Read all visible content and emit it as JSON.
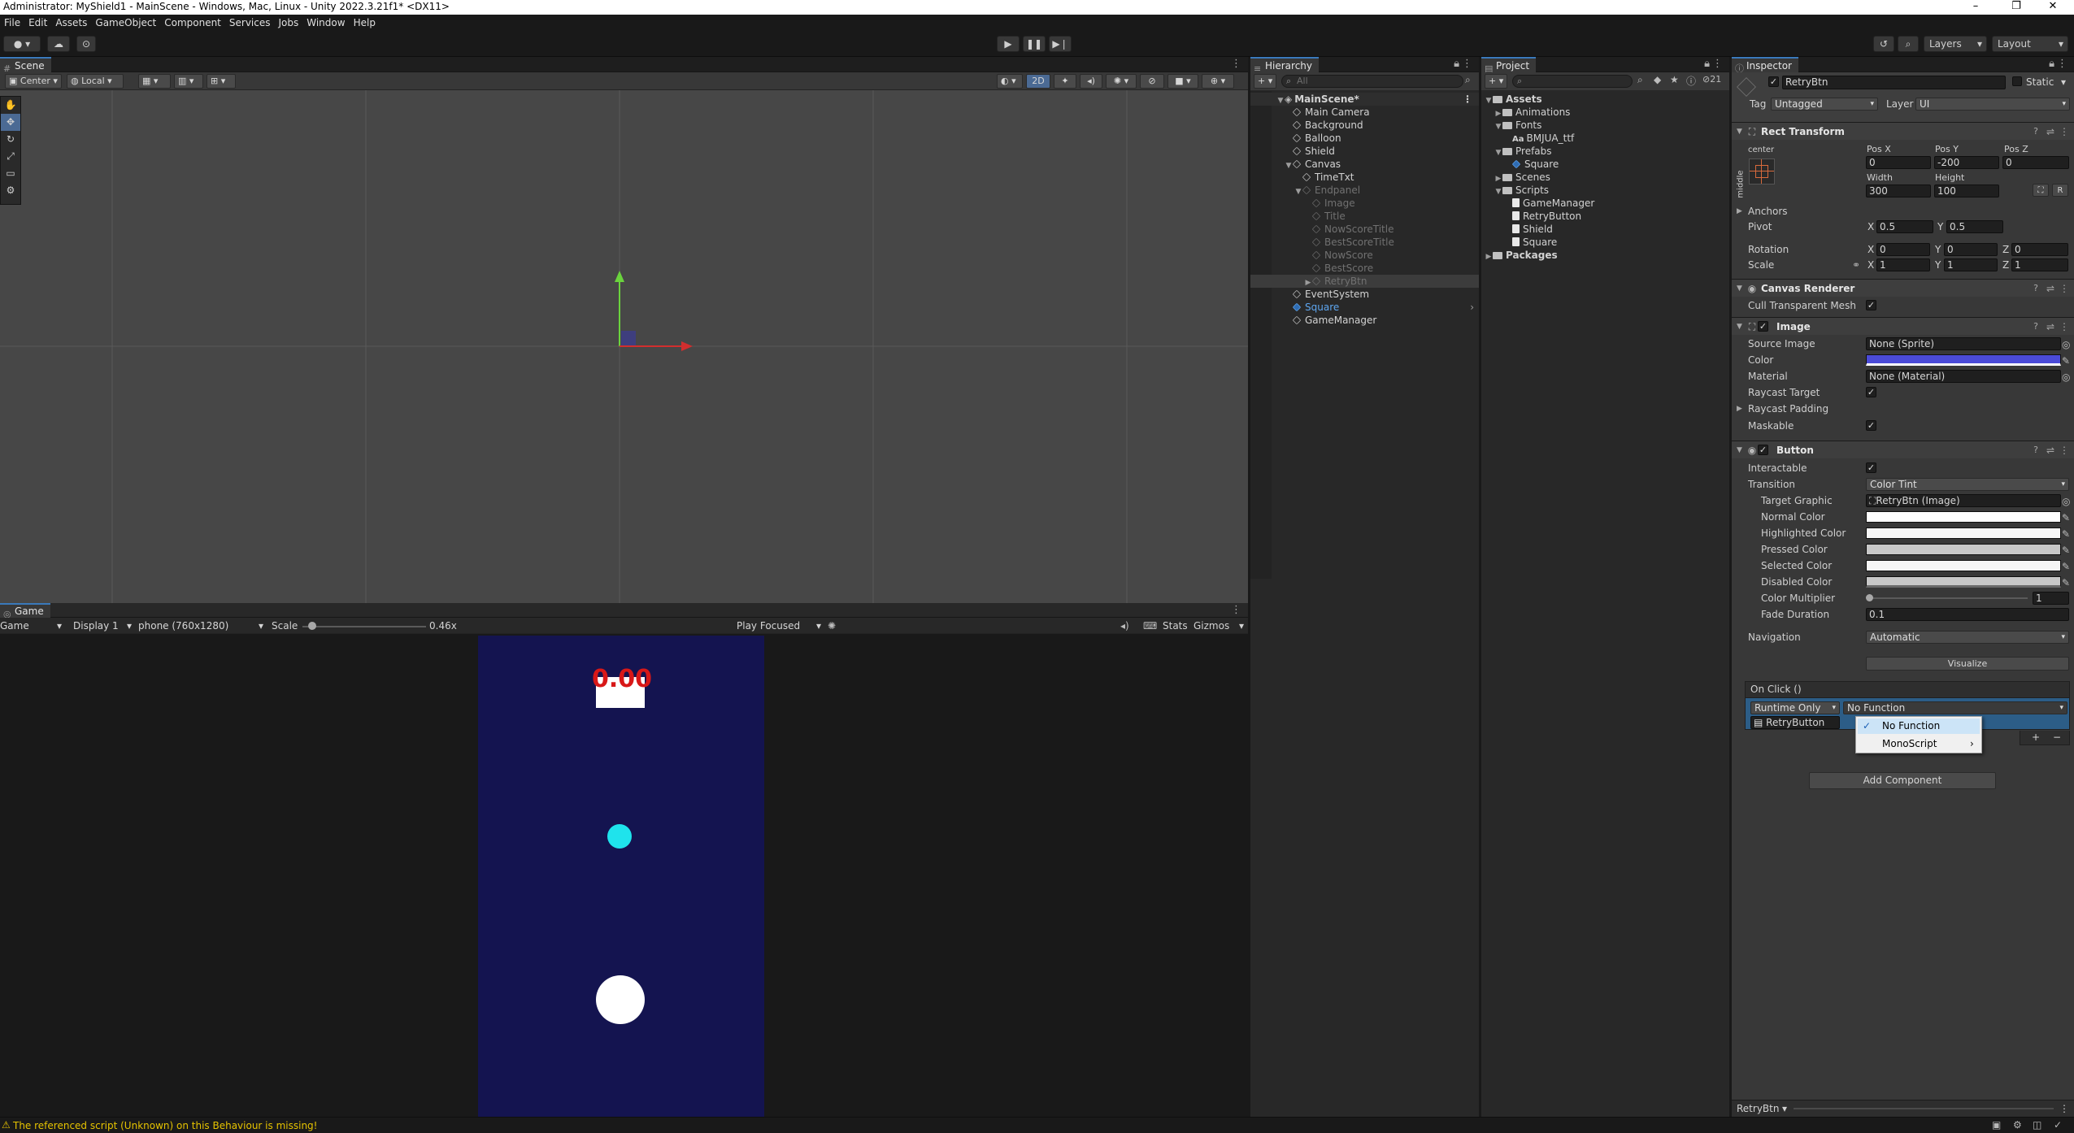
{
  "title_bar": {
    "title": "Administrator: MyShield1 - MainScene - Windows, Mac, Linux - Unity 2022.3.21f1* <DX11>",
    "minimize": "–",
    "maximize": "❐",
    "close": "✕"
  },
  "menu": [
    "File",
    "Edit",
    "Assets",
    "GameObject",
    "Component",
    "Services",
    "Jobs",
    "Window",
    "Help"
  ],
  "toolbar": {
    "layers": "Layers",
    "layout": "Layout"
  },
  "scene": {
    "tab": "Scene",
    "pivot": "Center",
    "space": "Local",
    "mode_2d": "2D"
  },
  "game": {
    "tab": "Game",
    "view": "Game",
    "display": "Display 1",
    "resolution": "phone (760x1280)",
    "scale_label": "Scale",
    "scale_value": "0.46x",
    "scale_fraction": 0.08,
    "play_mode": "Play Focused",
    "stats": "Stats",
    "gizmos": "Gizmos",
    "score_text": "0.00",
    "bg_color": "#141450",
    "ball_color": "#1fe3ec"
  },
  "hierarchy": {
    "tab": "Hierarchy",
    "search_placeholder": "All",
    "root": "MainScene*",
    "items": [
      {
        "label": "Main Camera",
        "indent": 1,
        "state": "normal"
      },
      {
        "label": "Background",
        "indent": 1,
        "state": "normal"
      },
      {
        "label": "Balloon",
        "indent": 1,
        "state": "normal"
      },
      {
        "label": "Shield",
        "indent": 1,
        "state": "normal"
      },
      {
        "label": "Canvas",
        "indent": 1,
        "state": "normal",
        "expanded": true
      },
      {
        "label": "TimeTxt",
        "indent": 2,
        "state": "normal"
      },
      {
        "label": "Endpanel",
        "indent": 2,
        "state": "dim",
        "expanded": true
      },
      {
        "label": "Image",
        "indent": 3,
        "state": "dim"
      },
      {
        "label": "Title",
        "indent": 3,
        "state": "dim"
      },
      {
        "label": "NowScoreTitle",
        "indent": 3,
        "state": "dim"
      },
      {
        "label": "BestScoreTitle",
        "indent": 3,
        "state": "dim"
      },
      {
        "label": "NowScore",
        "indent": 3,
        "state": "dim"
      },
      {
        "label": "BestScore",
        "indent": 3,
        "state": "dim"
      },
      {
        "label": "RetryBtn",
        "indent": 3,
        "state": "dim-selected",
        "collapsed": true
      },
      {
        "label": "EventSystem",
        "indent": 1,
        "state": "normal"
      },
      {
        "label": "Square",
        "indent": 1,
        "state": "prefab"
      },
      {
        "label": "GameManager",
        "indent": 1,
        "state": "normal"
      }
    ]
  },
  "project": {
    "tab": "Project",
    "count": "21",
    "items": [
      {
        "label": "Assets",
        "indent": 0,
        "kind": "folder",
        "open": true
      },
      {
        "label": "Animations",
        "indent": 1,
        "kind": "folder"
      },
      {
        "label": "Fonts",
        "indent": 1,
        "kind": "folder",
        "open": true
      },
      {
        "label": "BMJUA_ttf",
        "indent": 2,
        "kind": "font"
      },
      {
        "label": "Prefabs",
        "indent": 1,
        "kind": "folder",
        "open": true
      },
      {
        "label": "Square",
        "indent": 2,
        "kind": "prefab"
      },
      {
        "label": "Scenes",
        "indent": 1,
        "kind": "folder"
      },
      {
        "label": "Scripts",
        "indent": 1,
        "kind": "folder",
        "open": true
      },
      {
        "label": "GameManager",
        "indent": 2,
        "kind": "script"
      },
      {
        "label": "RetryButton",
        "indent": 2,
        "kind": "script"
      },
      {
        "label": "Shield",
        "indent": 2,
        "kind": "script"
      },
      {
        "label": "Square",
        "indent": 2,
        "kind": "script"
      },
      {
        "label": "Packages",
        "indent": 0,
        "kind": "folder"
      }
    ]
  },
  "inspector": {
    "tab": "Inspector",
    "object_name": "RetryBtn",
    "static": "Static",
    "tag_label": "Tag",
    "tag": "Untagged",
    "layer_label": "Layer",
    "layer": "UI",
    "rect": {
      "title": "Rect Transform",
      "anchor_h": "center",
      "anchor_v": "middle",
      "posx_label": "Pos X",
      "posx": "0",
      "posy_label": "Pos Y",
      "posy": "-200",
      "posz_label": "Pos Z",
      "posz": "0",
      "width_label": "Width",
      "width": "300",
      "height_label": "Height",
      "height": "100",
      "anchors": "Anchors",
      "pivot": "Pivot",
      "pivot_x": "0.5",
      "pivot_y": "0.5",
      "rotation": "Rotation",
      "rot_x": "0",
      "rot_y": "0",
      "rot_z": "0",
      "scale": "Scale",
      "scale_x": "1",
      "scale_y": "1",
      "scale_z": "1",
      "x": "X",
      "y": "Y",
      "z": "Z",
      "r": "R"
    },
    "canvas_renderer": {
      "title": "Canvas Renderer",
      "cull": "Cull Transparent Mesh"
    },
    "image": {
      "title": "Image",
      "source_label": "Source Image",
      "source": "None (Sprite)",
      "color_label": "Color",
      "color": "#4b4bd8",
      "material_label": "Material",
      "material": "None (Material)",
      "raycast_target": "Raycast Target",
      "raycast_padding": "Raycast Padding",
      "maskable": "Maskable"
    },
    "button": {
      "title": "Button",
      "interactable": "Interactable",
      "transition_label": "Transition",
      "transition": "Color Tint",
      "target_label": "Target Graphic",
      "target": "RetryBtn (Image)",
      "normal": "Normal Color",
      "normal_color": "#ffffff",
      "highlighted": "Highlighted Color",
      "highlighted_color": "#f5f5f5",
      "pressed": "Pressed Color",
      "pressed_color": "#c8c8c8",
      "selected": "Selected Color",
      "selected_color": "#f5f5f5",
      "disabled": "Disabled Color",
      "disabled_color": "#c8c8c8",
      "multiplier_label": "Color Multiplier",
      "multiplier": "1",
      "fade_label": "Fade Duration",
      "fade": "0.1",
      "navigation_label": "Navigation",
      "navigation": "Automatic",
      "visualize": "Visualize",
      "onclick": "On Click ()",
      "runtime": "Runtime Only",
      "function": "No Function",
      "object": "RetryButton",
      "add": "+",
      "remove": "−"
    },
    "popup": {
      "items": [
        "No Function",
        "MonoScript"
      ]
    },
    "add_component": "Add Component",
    "footer_label": "RetryBtn"
  },
  "status": {
    "message": "The referenced script (Unknown) on this Behaviour is missing!"
  }
}
